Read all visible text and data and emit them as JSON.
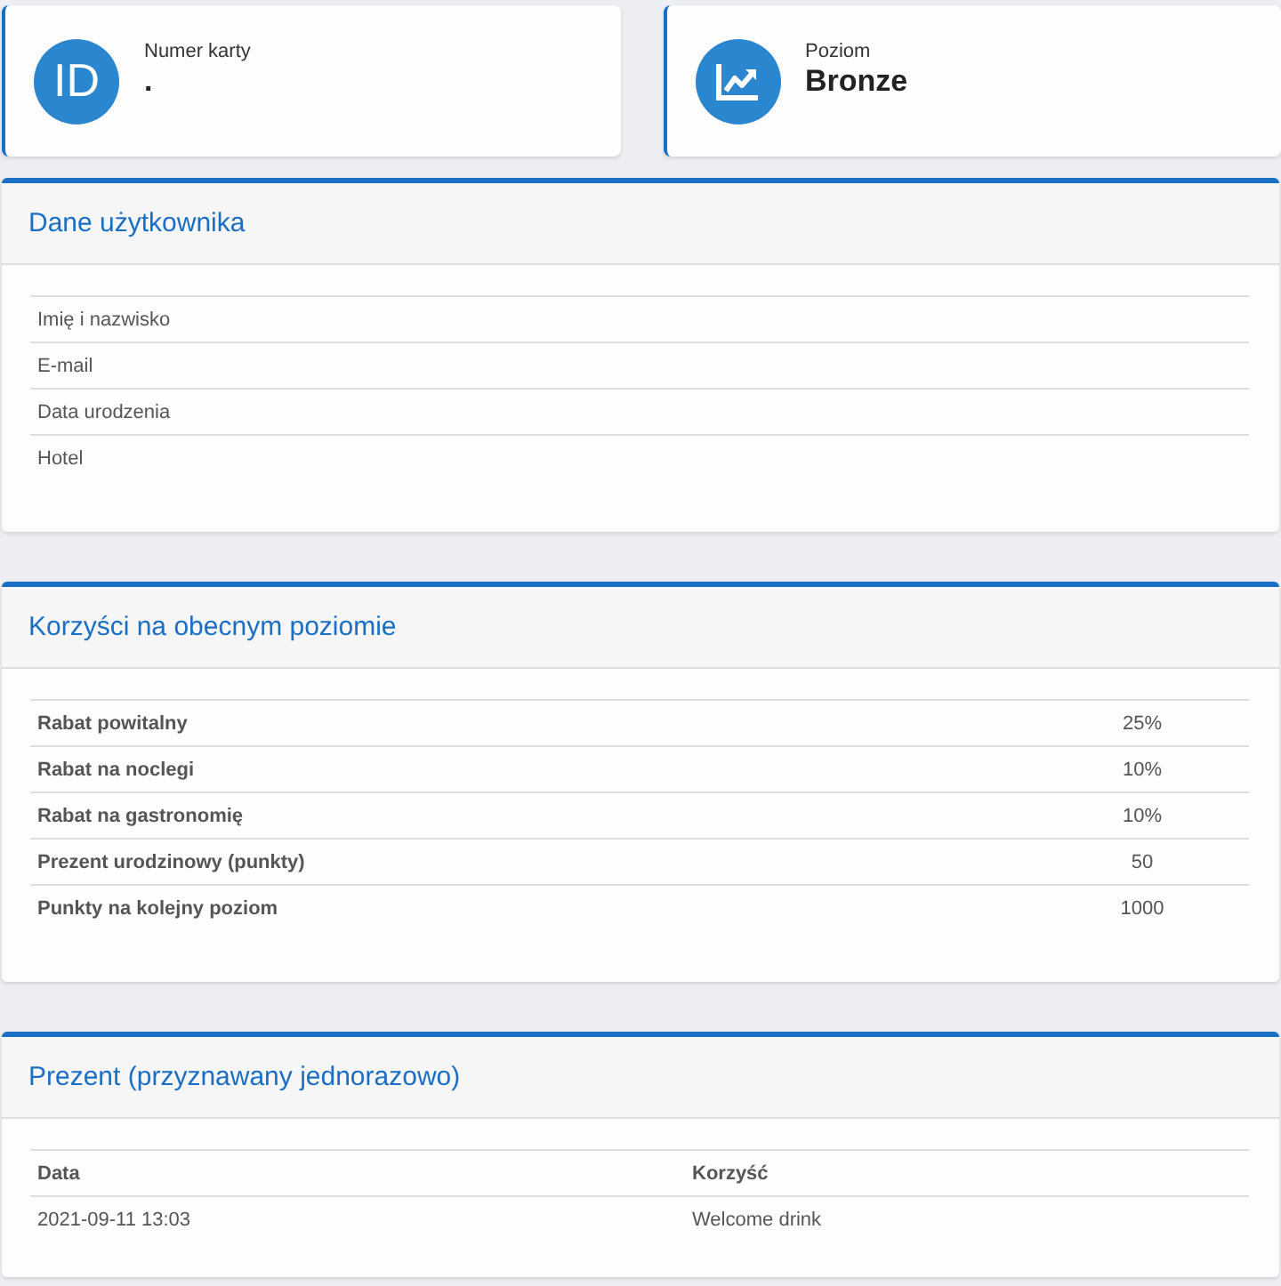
{
  "cards": [
    {
      "kind": "text",
      "icon_text": "ID",
      "label": "Numer karty",
      "value": "."
    },
    {
      "kind": "chart",
      "label": "Poziom",
      "value": "Bronze"
    }
  ],
  "sections": [
    {
      "kind": "fields",
      "title": "Dane użytkownika",
      "rows": [
        {
          "label": "Imię i nazwisko"
        },
        {
          "label": "E-mail"
        },
        {
          "label": "Data urodzenia"
        },
        {
          "label": "Hotel"
        }
      ]
    },
    {
      "kind": "benefits",
      "title": "Korzyści na obecnym poziomie",
      "rows": [
        {
          "label": "Rabat powitalny",
          "value": "25%"
        },
        {
          "label": "Rabat na noclegi",
          "value": "10%"
        },
        {
          "label": "Rabat na gastronomię",
          "value": "10%"
        },
        {
          "label": "Prezent urodzinowy (punkty)",
          "value": "50"
        },
        {
          "label": "Punkty na kolejny poziom",
          "value": "1000"
        }
      ]
    },
    {
      "kind": "table",
      "title": "Prezent (przyznawany jednorazowo)",
      "columns": [
        "Data",
        "Korzyść"
      ],
      "rows": [
        [
          "2021-09-11 13:03",
          "Welcome drink"
        ]
      ]
    }
  ]
}
